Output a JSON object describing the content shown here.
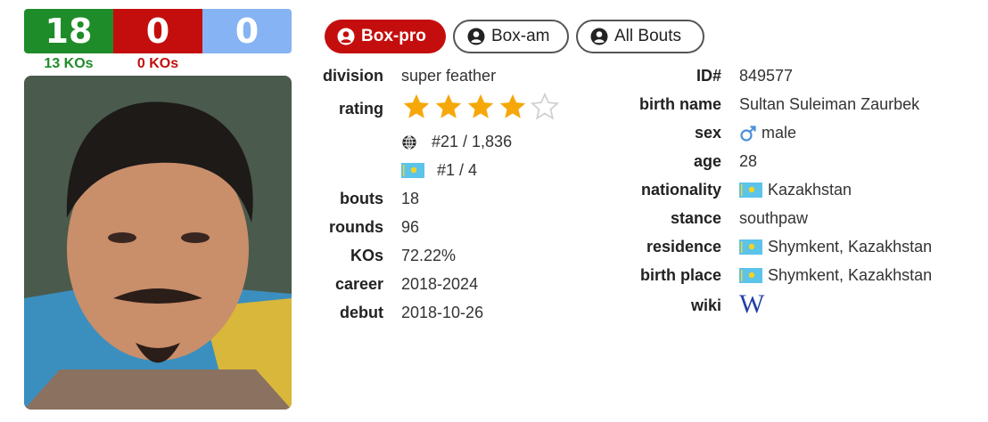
{
  "record": {
    "wins": "18",
    "losses": "0",
    "draws": "0",
    "win_kos": "13 KOs",
    "loss_kos": "0 KOs",
    "colors": {
      "win": "#1f8c2a",
      "loss": "#c40e0e",
      "draw": "#86b3f3"
    }
  },
  "tabs": [
    {
      "label": "Box-pro",
      "active": true,
      "icon": "user-circle-icon"
    },
    {
      "label": "Box-am",
      "active": false,
      "icon": "user-circle-icon"
    },
    {
      "label": "All Bouts",
      "active": false,
      "icon": "user-circle-icon"
    }
  ],
  "left_fields": {
    "division": {
      "label": "division",
      "value": "super feather"
    },
    "rating": {
      "label": "rating",
      "stars_filled": 4,
      "stars_total": 5,
      "world_rank": "#21 / 1,836",
      "country_rank": "#1 / 4"
    },
    "bouts": {
      "label": "bouts",
      "value": "18"
    },
    "rounds": {
      "label": "rounds",
      "value": "96"
    },
    "kos": {
      "label": "KOs",
      "value": "72.22%"
    },
    "career": {
      "label": "career",
      "value": "2018-2024"
    },
    "debut": {
      "label": "debut",
      "value": "2018-10-26"
    }
  },
  "right_fields": {
    "id": {
      "label": "ID#",
      "value": "849577"
    },
    "birth_name": {
      "label": "birth name",
      "value": "Sultan Suleiman Zaurbek"
    },
    "sex": {
      "label": "sex",
      "value": "male",
      "icon": "male-icon"
    },
    "age": {
      "label": "age",
      "value": "28"
    },
    "nationality": {
      "label": "nationality",
      "value": "Kazakhstan",
      "icon": "kazakhstan-flag-icon"
    },
    "stance": {
      "label": "stance",
      "value": "southpaw"
    },
    "residence": {
      "label": "residence",
      "value": "Shymkent, Kazakhstan",
      "icon": "kazakhstan-flag-icon"
    },
    "birth_place": {
      "label": "birth place",
      "value": "Shymkent, Kazakhstan",
      "icon": "kazakhstan-flag-icon"
    },
    "wiki": {
      "label": "wiki",
      "icon": "wikipedia-icon",
      "glyph": "W"
    }
  }
}
